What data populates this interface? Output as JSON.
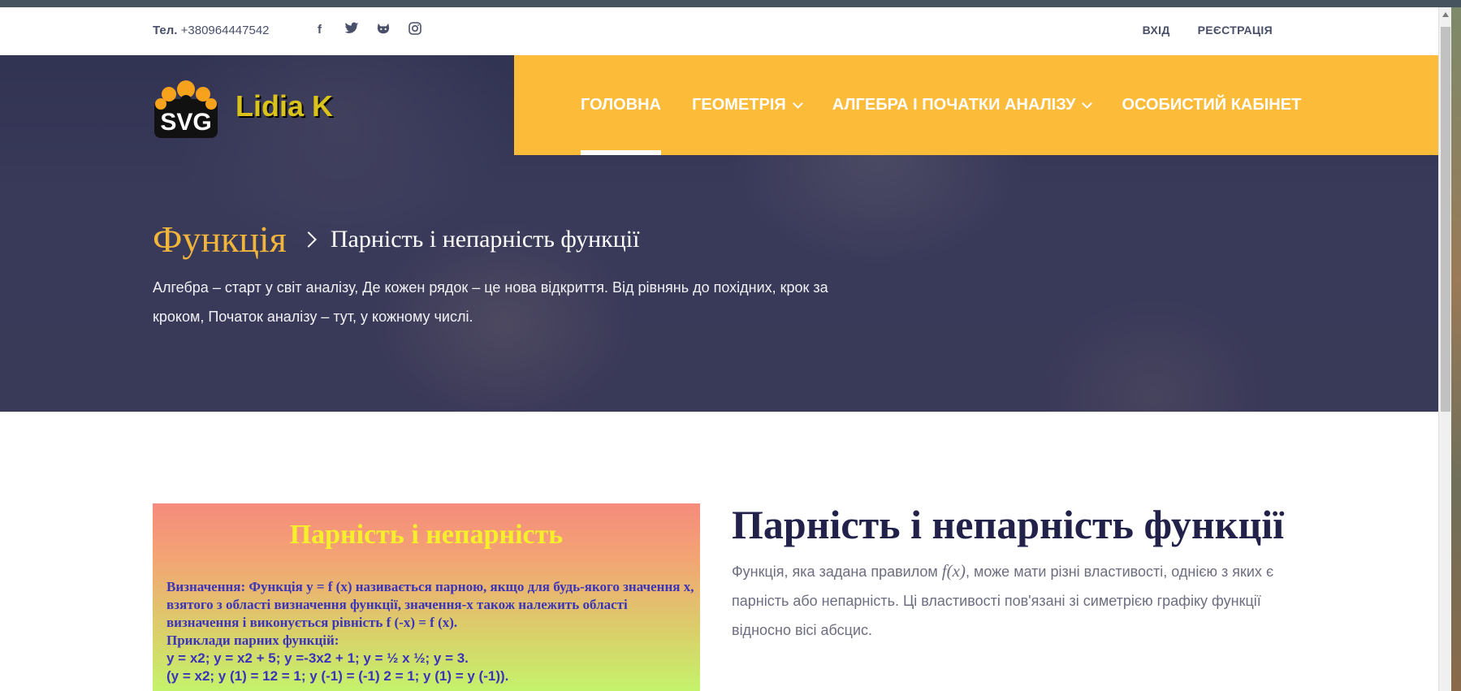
{
  "topbar": {
    "phone_label": "Тел.",
    "phone_number": "+380964447542",
    "social": [
      {
        "icon": "facebook-icon",
        "glyph": "f"
      },
      {
        "icon": "twitter-icon",
        "glyph": "t"
      },
      {
        "icon": "github-icon",
        "glyph": "g"
      },
      {
        "icon": "instagram-icon",
        "glyph": "i"
      }
    ],
    "login": "ВХІД",
    "register": "РЕЄСТРАЦІЯ"
  },
  "logo": {
    "mark_text": "SVG",
    "name": "Lidia K"
  },
  "nav": {
    "items": [
      {
        "label": "ГОЛОВНА",
        "active": true,
        "dropdown": false
      },
      {
        "label": "ГЕОМЕТРІЯ",
        "active": false,
        "dropdown": true
      },
      {
        "label": "АЛГЕБРА І ПОЧАТКИ АНАЛІЗУ",
        "active": false,
        "dropdown": true
      },
      {
        "label": "ОСОБИСТИЙ КАБІНЕТ",
        "active": false,
        "dropdown": false
      }
    ]
  },
  "hero": {
    "crumb_root": "Функція",
    "crumb_current": "Парність і непарність функції",
    "text": "Алгебра – старт у світ аналізу, Де кожен рядок – це нова відкриття. Від рівнянь до похідних, крок за кроком, Початок аналізу – тут, у кожному числі."
  },
  "image_card": {
    "title": "Парність і непарність",
    "line1": " Визначення: Функція y = f (x) називається парною, якщо для будь-якого значення x, взятого з області визначення функції, значення-x також належить області визначення і виконується рівність f (-x) = f (x).",
    "line2": "  Приклади парних функцій:",
    "line3": "  y = x2; y = x2 + 5; y =-3x2 + 1; y = ½ x ½; y = 3.",
    "line4": "(y = x2; y (1) = 12 = 1; y (-1) = (-1) 2 = 1; y (1) = y (-1))."
  },
  "article": {
    "title": "Парність і непарність функції",
    "text_before": "Функція, яка задана правилом ",
    "formula": "f(x)",
    "text_after": ", може мати різні властивості, однією з яких є парність або непарність. Ці властивості пов'язані зі симетрією графіку функції відносно вісі абсцис."
  },
  "colors": {
    "accent": "#fdbb3a",
    "heading": "#22214a",
    "crumb_root": "#f2b53c"
  }
}
